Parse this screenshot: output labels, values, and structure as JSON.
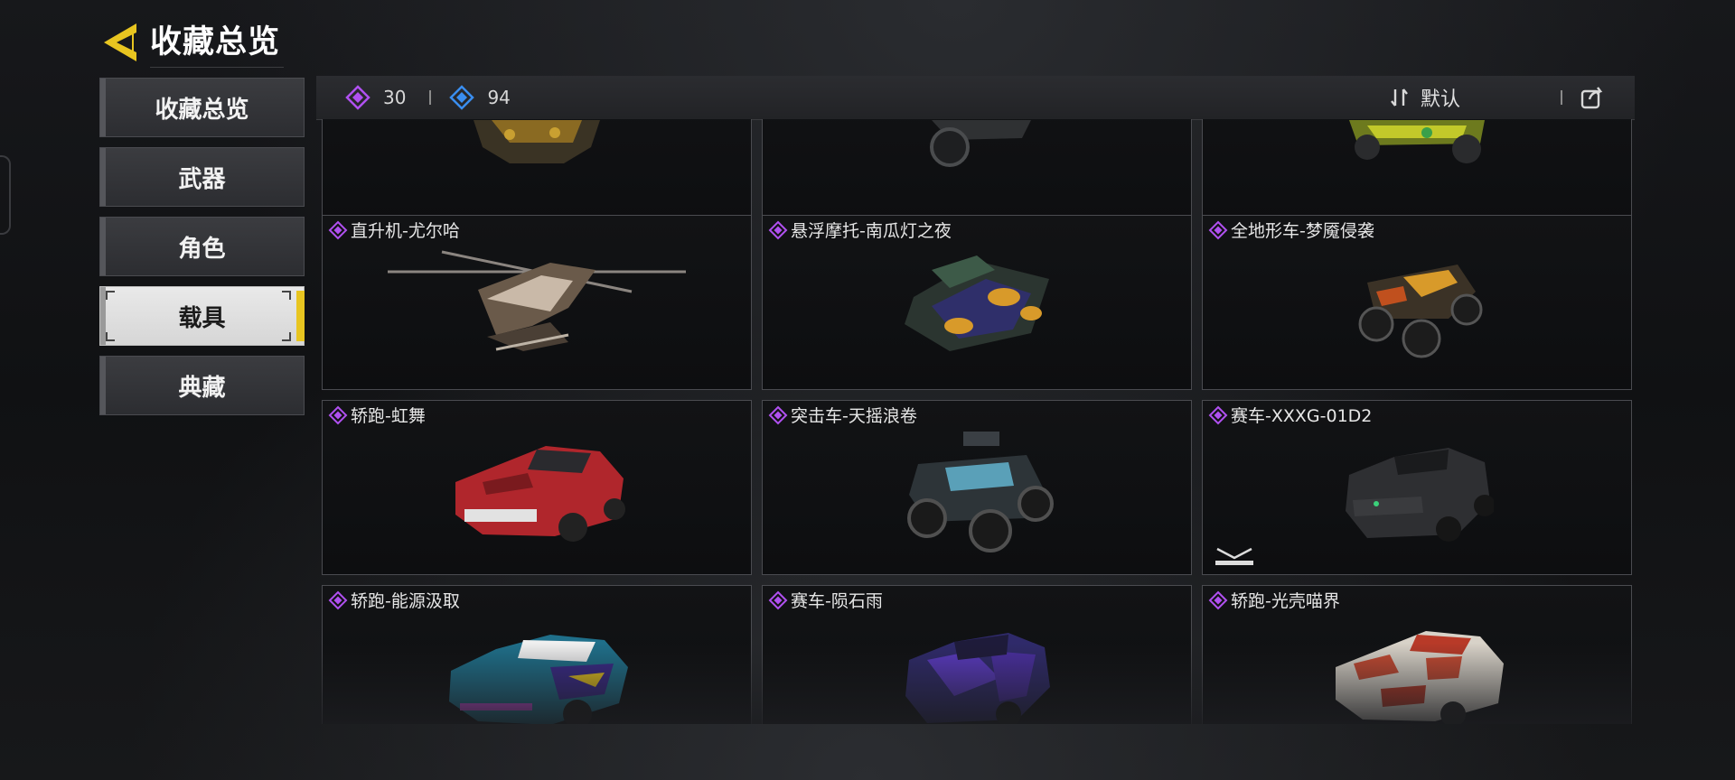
{
  "header": {
    "title": "收藏总览"
  },
  "sidebar": {
    "items": [
      {
        "label": "收藏总览",
        "active": false
      },
      {
        "label": "武器",
        "active": false
      },
      {
        "label": "角色",
        "active": false
      },
      {
        "label": "载具",
        "active": true
      },
      {
        "label": "典藏",
        "active": false
      }
    ]
  },
  "topbar": {
    "legendary_count": "30",
    "epic_count": "94",
    "sort_label": "默认"
  },
  "colors": {
    "accent": "#E8C520",
    "legendary": "#B050F0",
    "epic": "#3A8EF0"
  },
  "cards": [
    {
      "label": "",
      "icon": "vehicle-partial-art",
      "rarity": "legendary"
    },
    {
      "label": "",
      "icon": "vehicle-partial-art",
      "rarity": "legendary"
    },
    {
      "label": "",
      "icon": "vehicle-partial-art",
      "rarity": "legendary"
    },
    {
      "label": "直升机-尤尔哈",
      "icon": "helicopter-art",
      "rarity": "legendary"
    },
    {
      "label": "悬浮摩托-南瓜灯之夜",
      "icon": "hover-bike-art",
      "rarity": "legendary"
    },
    {
      "label": "全地形车-梦魇侵袭",
      "icon": "atv-art",
      "rarity": "legendary"
    },
    {
      "label": "轿跑-虹舞",
      "icon": "coupe-art",
      "rarity": "legendary"
    },
    {
      "label": "突击车-天摇浪卷",
      "icon": "assault-vehicle-art",
      "rarity": "legendary"
    },
    {
      "label": "赛车-XXXG-01D2",
      "icon": "race-car-art",
      "rarity": "legendary"
    },
    {
      "label": "轿跑-能源汲取",
      "icon": "coupe-art",
      "rarity": "legendary"
    },
    {
      "label": "赛车-陨石雨",
      "icon": "race-car-art",
      "rarity": "legendary"
    },
    {
      "label": "轿跑-光壳喵界",
      "icon": "coupe-art",
      "rarity": "legendary"
    }
  ]
}
